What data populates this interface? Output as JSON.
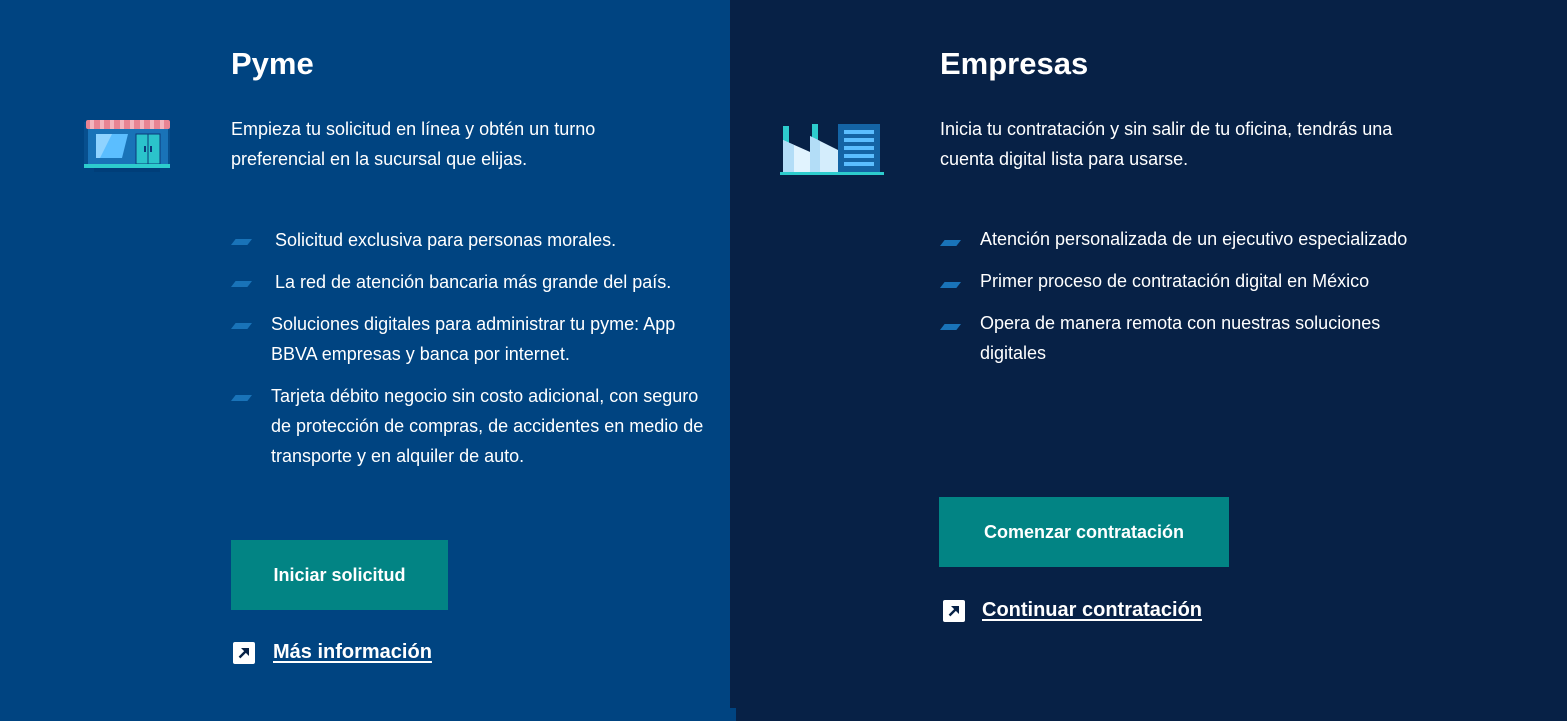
{
  "pyme": {
    "title": "Pyme",
    "description": "Empieza tu solicitud en línea y obtén un turno preferencial en la sucursal que elijas.",
    "bullets": [
      "Solicitud exclusiva para personas morales.",
      "La red de atención bancaria más grande del país.",
      "Soluciones digitales para administrar tu pyme: App BBVA empresas y banca por internet.",
      "Tarjeta débito negocio sin costo adicional, con seguro de protección de compras, de accidentes en medio de transporte y en alquiler de auto."
    ],
    "button_label": "Iniciar solicitud",
    "link_label": "Más información",
    "illustration": "store-icon"
  },
  "empresas": {
    "title": "Empresas",
    "description": "Inicia tu contratación y sin salir de tu oficina, tendrás una cuenta digital lista para usarse.",
    "bullets": [
      "Atención personalizada de un ejecutivo especializado",
      "Primer proceso de contratación digital en México",
      "Opera de manera remota con nuestras soluciones digitales"
    ],
    "button_label": "Comenzar contratación",
    "link_label": "Continuar contratación",
    "illustration": "factory-icon"
  },
  "colors": {
    "left_background": "#004481",
    "right_background": "#072146",
    "button": "#028484",
    "bullet": "#1973b8",
    "text": "#ffffff"
  },
  "icons": {
    "link_icon": "external-arrow-icon",
    "bullet_icon": "parallelogram-bullet-icon"
  }
}
